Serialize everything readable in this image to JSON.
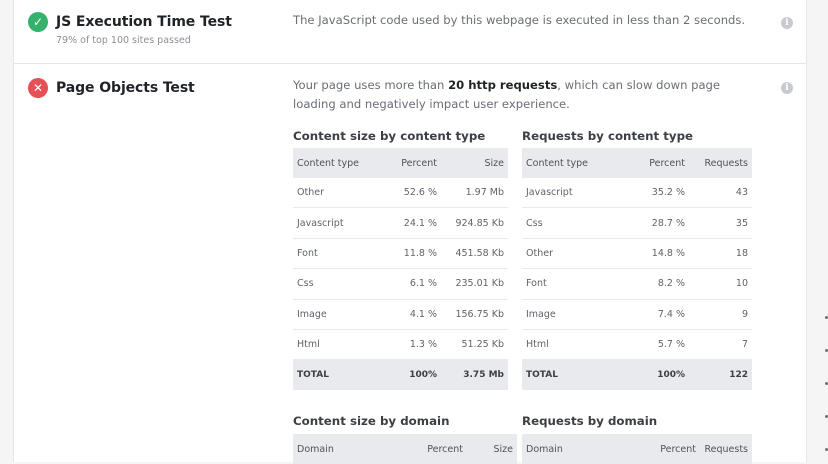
{
  "js_test": {
    "status": "pass",
    "title": "JS Execution Time Test",
    "subtitle": "79% of top 100 sites passed",
    "description": "The JavaScript code used by this webpage is executed in less than 2 seconds."
  },
  "objects_test": {
    "status": "fail",
    "title": "Page Objects Test",
    "desc_before": "Your page uses more than ",
    "desc_bold": "20 http requests",
    "desc_after": ", which can slow down page loading and negatively impact user experience."
  },
  "icons": {
    "pass": "check-icon",
    "fail": "x-icon",
    "info": "info-icon"
  },
  "colors": {
    "pass": "#35b16b",
    "fail": "#e45156",
    "info": "#c8cacf",
    "header_bg": "#e8eaee"
  },
  "tables": {
    "size_by_type": {
      "title": "Content size by content type",
      "headers": [
        "Content type",
        "Percent",
        "Size"
      ],
      "rows": [
        [
          "Other",
          "52.6 %",
          "1.97 Mb"
        ],
        [
          "Javascript",
          "24.1 %",
          "924.85 Kb"
        ],
        [
          "Font",
          "11.8 %",
          "451.58 Kb"
        ],
        [
          "Css",
          "6.1 %",
          "235.01 Kb"
        ],
        [
          "Image",
          "4.1 %",
          "156.75 Kb"
        ],
        [
          "Html",
          "1.3 %",
          "51.25 Kb"
        ]
      ],
      "total": [
        "TOTAL",
        "100%",
        "3.75 Mb"
      ]
    },
    "requests_by_type": {
      "title": "Requests by content type",
      "headers": [
        "Content type",
        "Percent",
        "Requests"
      ],
      "rows": [
        [
          "Javascript",
          "35.2 %",
          "43"
        ],
        [
          "Css",
          "28.7 %",
          "35"
        ],
        [
          "Other",
          "14.8 %",
          "18"
        ],
        [
          "Font",
          "8.2 %",
          "10"
        ],
        [
          "Image",
          "7.4 %",
          "9"
        ],
        [
          "Html",
          "5.7 %",
          "7"
        ]
      ],
      "total": [
        "TOTAL",
        "100%",
        "122"
      ]
    },
    "size_by_domain": {
      "title": "Content size by domain",
      "headers": [
        "Domain",
        "Percent",
        "Size"
      ]
    },
    "requests_by_domain": {
      "title": "Requests by domain",
      "headers": [
        "Domain",
        "Percent",
        "Requests"
      ]
    }
  }
}
